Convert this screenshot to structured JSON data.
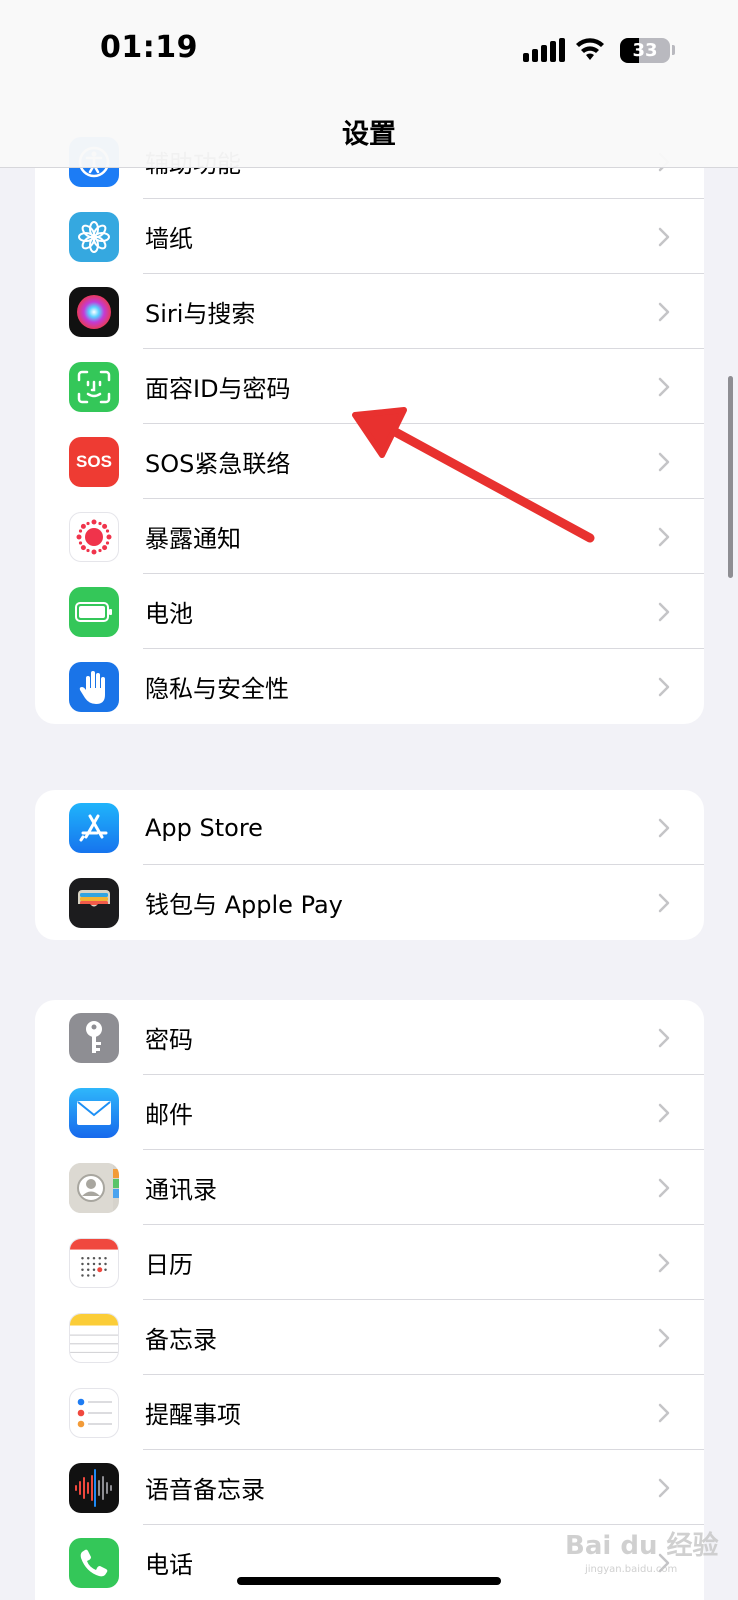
{
  "status": {
    "time": "01:19",
    "battery": "33"
  },
  "nav": {
    "title": "设置"
  },
  "group1": [
    {
      "label": "辅助功能",
      "icon": "accessibility-icon"
    },
    {
      "label": "墙纸",
      "icon": "wallpaper-icon"
    },
    {
      "label": "Siri与搜索",
      "icon": "siri-icon"
    },
    {
      "label": "面容ID与密码",
      "icon": "face-id-icon"
    },
    {
      "label": "SOS紧急联络",
      "icon": "sos-icon",
      "icon_text": "SOS"
    },
    {
      "label": "暴露通知",
      "icon": "exposure-icon"
    },
    {
      "label": "电池",
      "icon": "battery-icon"
    },
    {
      "label": "隐私与安全性",
      "icon": "privacy-hand-icon"
    }
  ],
  "group2": [
    {
      "label": "App Store",
      "icon": "app-store-icon"
    },
    {
      "label": "钱包与 Apple Pay",
      "icon": "wallet-icon"
    }
  ],
  "group3": [
    {
      "label": "密码",
      "icon": "key-icon"
    },
    {
      "label": "邮件",
      "icon": "mail-icon"
    },
    {
      "label": "通讯录",
      "icon": "contacts-icon"
    },
    {
      "label": "日历",
      "icon": "calendar-icon"
    },
    {
      "label": "备忘录",
      "icon": "notes-icon"
    },
    {
      "label": "提醒事项",
      "icon": "reminders-icon"
    },
    {
      "label": "语音备忘录",
      "icon": "voice-memos-icon"
    },
    {
      "label": "电话",
      "icon": "phone-icon"
    }
  ],
  "watermark": {
    "text": "Bai du 经验",
    "sub": "jingyan.baidu.com"
  },
  "colors": {
    "background": "#f2f2f7",
    "accessibility": "#1c7cf5",
    "wallpaper": "#35a8e0",
    "faceid": "#34c759",
    "sos": "#ee3b33",
    "battery": "#34c759",
    "privacy": "#1a74e8",
    "appstore": "#1e8af5",
    "mail": "#1e90f5",
    "annotation_arrow": "#e8312f"
  }
}
